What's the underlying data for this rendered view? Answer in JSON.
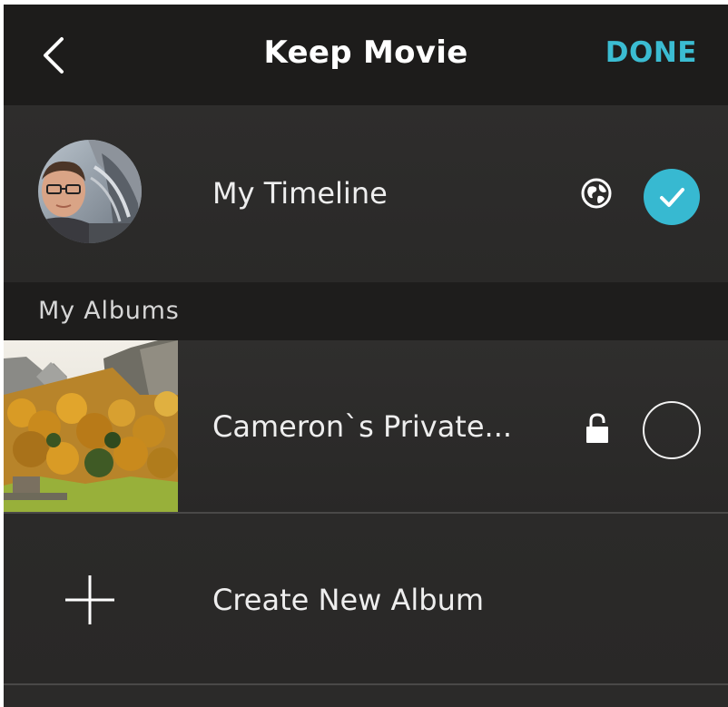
{
  "nav": {
    "title": "Keep Movie",
    "done_label": "DONE",
    "back_icon": "chevron-left-icon"
  },
  "timeline": {
    "label": "My Timeline",
    "visibility_icon": "globe-icon",
    "selected": true
  },
  "albums_section": {
    "title": "My Albums"
  },
  "albums": [
    {
      "label": "Cameron`s Private...",
      "privacy_icon": "lock-icon",
      "selected": false
    }
  ],
  "create_album": {
    "label": "Create New Album",
    "icon": "plus-icon"
  },
  "colors": {
    "accent": "#37b9d1",
    "nav_background": "#1d1c1b",
    "row_background": "#2b2a29",
    "section_background": "#1e1d1c",
    "text": "#eeeeee"
  }
}
